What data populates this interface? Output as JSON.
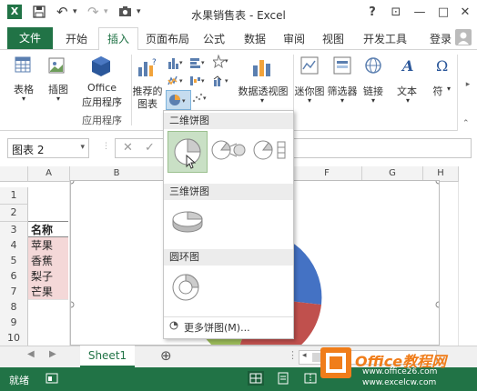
{
  "window": {
    "title": "水果销售表 - Excel",
    "help": "?",
    "ribbon_display": "⊡",
    "minimize": "—",
    "restore": "□",
    "close": "✕"
  },
  "quick_access": {
    "save": "💾",
    "undo": "↶",
    "redo": "↷",
    "camera": "📷",
    "dropdown": "▾"
  },
  "tabs": {
    "file": "文件",
    "home": "开始",
    "insert": "插入",
    "page_layout": "页面布局",
    "formulas": "公式",
    "data": "数据",
    "review": "审阅",
    "view": "视图",
    "developer": "开发工具",
    "login": "登录"
  },
  "ribbon": {
    "table": "表格",
    "illustrations": "插图",
    "office_apps_line1": "Office",
    "office_apps_line2": "应用程序",
    "group_apps": "应用程序",
    "recommended_line1": "推荐的",
    "recommended_line2": "图表",
    "pivot_chart": "数据透视图",
    "sparklines": "迷你图",
    "slicer": "筛选器",
    "links": "链接",
    "text": "文本",
    "symbols": "符"
  },
  "formula": {
    "name_box": "图表 2",
    "cancel": "✕",
    "enter": "✓"
  },
  "columns": [
    "A",
    "B",
    "F",
    "G",
    "H"
  ],
  "rows": [
    "1",
    "2",
    "3",
    "4",
    "5",
    "6",
    "7",
    "8",
    "9",
    "10"
  ],
  "cells": {
    "a3": "名称",
    "a4": "苹果",
    "a5": "香蕉",
    "a6": "梨子",
    "a7": "芒果"
  },
  "dropdown": {
    "section_2d": "二维饼图",
    "section_3d": "三维饼图",
    "section_donut": "圆环图",
    "more": "更多饼图(M)..."
  },
  "sheets": {
    "active": "Sheet1",
    "add": "⊕",
    "more": "⋮"
  },
  "status": {
    "ready": "就绪"
  },
  "watermark": {
    "brand": "Office教程网",
    "url1": "www.office26.com",
    "url2": "www.excelcw.com"
  },
  "colors": {
    "excel_green": "#217346",
    "pie_blue": "#4472c4",
    "pie_red": "#c0504d",
    "pie_green": "#9bbb59",
    "watermark_orange": "#f07d1a"
  }
}
